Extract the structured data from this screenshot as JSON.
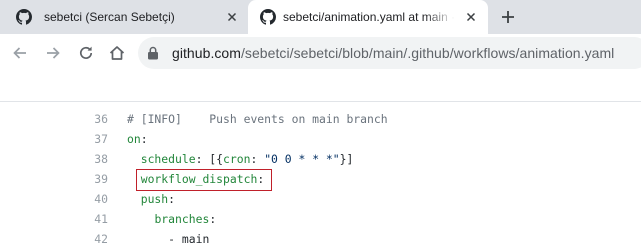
{
  "tabs": [
    {
      "title": "sebetci (Sercan Sebetçi)",
      "icon": "github-icon",
      "active": false
    },
    {
      "title": "sebetci/animation.yaml at main · sebetci",
      "icon": "github-icon",
      "active": true
    }
  ],
  "newtab_icon": "plus-icon",
  "toolbar": {
    "url_host": "github.com",
    "url_path": "/sebetci/sebetci/blob/main/.github/workflows/animation.yaml"
  },
  "code": {
    "lines": [
      {
        "number": "36",
        "tokens": [
          {
            "t": "# [INFO]    Push events on main branch",
            "c": "comment"
          }
        ]
      },
      {
        "number": "37",
        "tokens": [
          {
            "t": "on",
            "c": "key"
          },
          {
            "t": ":",
            "c": "plain"
          }
        ]
      },
      {
        "number": "38",
        "tokens": [
          {
            "t": "  ",
            "c": "plain"
          },
          {
            "t": "schedule",
            "c": "key"
          },
          {
            "t": ": [{",
            "c": "plain"
          },
          {
            "t": "cron",
            "c": "key"
          },
          {
            "t": ": ",
            "c": "plain"
          },
          {
            "t": "\"0 0 * * *\"",
            "c": "str"
          },
          {
            "t": "}]",
            "c": "plain"
          }
        ]
      },
      {
        "number": "39",
        "tokens": [
          {
            "t": "  ",
            "c": "plain"
          },
          {
            "t": "workflow_dispatch",
            "c": "key"
          },
          {
            "t": ":",
            "c": "plain"
          }
        ]
      },
      {
        "number": "40",
        "tokens": [
          {
            "t": "  ",
            "c": "plain"
          },
          {
            "t": "push",
            "c": "key"
          },
          {
            "t": ":",
            "c": "plain"
          }
        ]
      },
      {
        "number": "41",
        "tokens": [
          {
            "t": "    ",
            "c": "plain"
          },
          {
            "t": "branches",
            "c": "key"
          },
          {
            "t": ":",
            "c": "plain"
          }
        ]
      },
      {
        "number": "42",
        "tokens": [
          {
            "t": "      - ",
            "c": "plain"
          },
          {
            "t": "main",
            "c": "plain"
          }
        ]
      }
    ],
    "highlighted_line": "39",
    "highlight_color": "#c0202a"
  }
}
